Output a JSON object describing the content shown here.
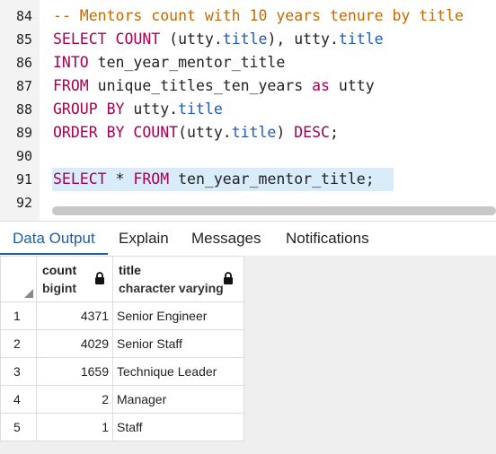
{
  "editor": {
    "lines": [
      {
        "num": "84",
        "tokens": [
          {
            "t": "-- Mentors count with 10 years tenure by title",
            "c": "cmt"
          }
        ]
      },
      {
        "num": "85",
        "tokens": [
          {
            "t": "SELECT COUNT",
            "c": "kw"
          },
          {
            "t": " (utty.",
            "c": "ident"
          },
          {
            "t": "title",
            "c": "prop"
          },
          {
            "t": "), utty.",
            "c": "ident"
          },
          {
            "t": "title",
            "c": "prop"
          }
        ]
      },
      {
        "num": "86",
        "tokens": [
          {
            "t": "INTO",
            "c": "kw"
          },
          {
            "t": " ten_year_mentor_title",
            "c": "ident"
          }
        ]
      },
      {
        "num": "87",
        "tokens": [
          {
            "t": "FROM",
            "c": "kw"
          },
          {
            "t": " unique_titles_ten_years ",
            "c": "ident"
          },
          {
            "t": "as",
            "c": "kw"
          },
          {
            "t": " utty",
            "c": "ident"
          }
        ]
      },
      {
        "num": "88",
        "tokens": [
          {
            "t": "GROUP BY",
            "c": "kw"
          },
          {
            "t": " utty.",
            "c": "ident"
          },
          {
            "t": "title",
            "c": "prop"
          }
        ]
      },
      {
        "num": "89",
        "tokens": [
          {
            "t": "ORDER BY COUNT",
            "c": "kw"
          },
          {
            "t": "(utty.",
            "c": "ident"
          },
          {
            "t": "title",
            "c": "prop"
          },
          {
            "t": ") ",
            "c": "ident"
          },
          {
            "t": "DESC",
            "c": "kw"
          },
          {
            "t": ";",
            "c": "ident"
          }
        ]
      },
      {
        "num": "90",
        "tokens": []
      },
      {
        "num": "91",
        "tokens": [
          {
            "t": "SELECT",
            "c": "kw"
          },
          {
            "t": " * ",
            "c": "ident"
          },
          {
            "t": "FROM",
            "c": "kw"
          },
          {
            "t": " ten_year_mentor_title;",
            "c": "ident"
          }
        ]
      },
      {
        "num": "92",
        "tokens": []
      }
    ]
  },
  "tabs": {
    "data_output": "Data Output",
    "explain": "Explain",
    "messages": "Messages",
    "notifications": "Notifications"
  },
  "grid": {
    "columns": [
      {
        "name": "count",
        "type": "bigint"
      },
      {
        "name": "title",
        "type": "character varying"
      }
    ],
    "rows": [
      {
        "num": "1",
        "count": "4371",
        "title": "Senior Engineer"
      },
      {
        "num": "2",
        "count": "4029",
        "title": "Senior Staff"
      },
      {
        "num": "3",
        "count": "1659",
        "title": "Technique Leader"
      },
      {
        "num": "4",
        "count": "2",
        "title": "Manager"
      },
      {
        "num": "5",
        "count": "1",
        "title": "Staff"
      }
    ]
  }
}
